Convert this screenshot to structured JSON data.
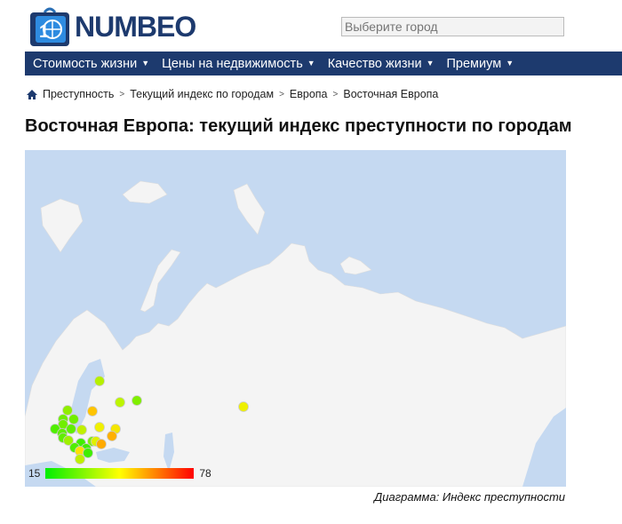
{
  "header": {
    "logo_text": "NUMBEO",
    "search_placeholder": "Выберите город"
  },
  "nav": [
    {
      "label": "Стоимость жизни"
    },
    {
      "label": "Цены на недвижимость"
    },
    {
      "label": "Качество жизни"
    },
    {
      "label": "Премиум"
    }
  ],
  "breadcrumb": [
    "Преступность",
    "Текущий индекс по городам",
    "Европа",
    "Восточная Европа"
  ],
  "page_title": "Восточная Европа: текущий индекс преступности по городам",
  "map": {
    "legend": {
      "min": "15",
      "max": "78"
    },
    "colors": {
      "sea": "#c5d9f1",
      "land": "#f4f4f4",
      "scale_low": "#00ee00",
      "scale_mid": "#ffff00",
      "scale_high": "#ff0000"
    },
    "caption": "Диаграмма: Индекс преступности"
  }
}
